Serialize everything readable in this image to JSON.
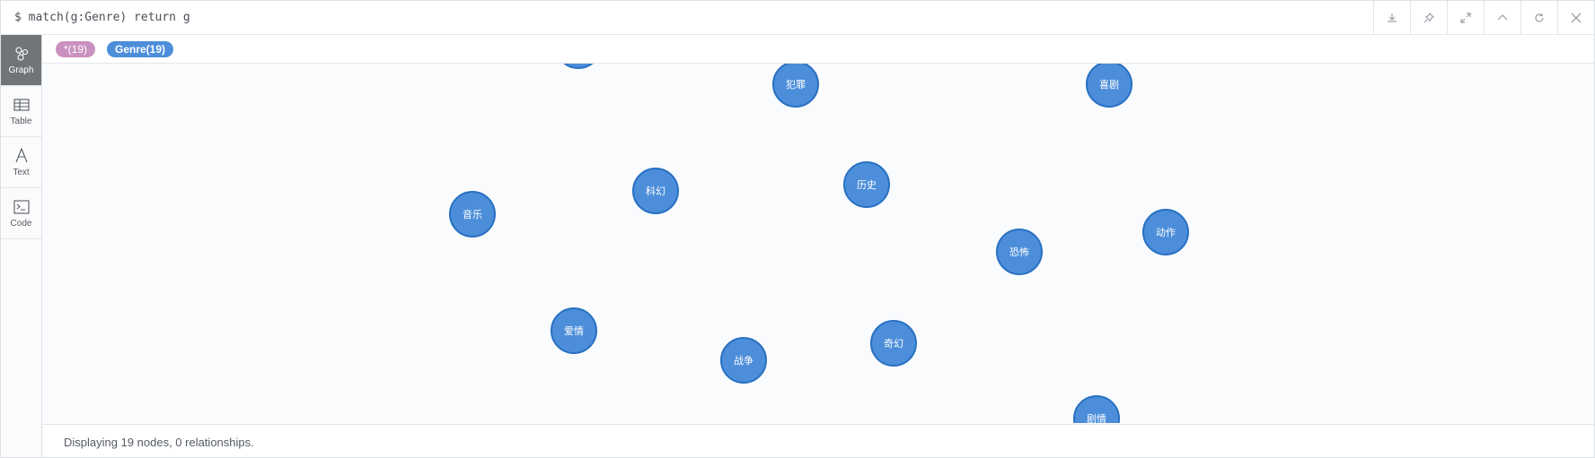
{
  "header": {
    "query": "$ match(g:Genre) return g",
    "buttons": [
      {
        "name": "download-icon"
      },
      {
        "name": "pin-icon"
      },
      {
        "name": "expand-icon"
      },
      {
        "name": "collapse-icon"
      },
      {
        "name": "rerun-icon"
      },
      {
        "name": "close-icon"
      }
    ]
  },
  "sidebar": {
    "items": [
      {
        "label": "Graph",
        "icon": "graph-icon",
        "active": true
      },
      {
        "label": "Table",
        "icon": "table-icon",
        "active": false
      },
      {
        "label": "Text",
        "icon": "text-icon",
        "active": false
      },
      {
        "label": "Code",
        "icon": "code-icon",
        "active": false
      }
    ]
  },
  "tags": {
    "all": "*(19)",
    "genre": "Genre(19)"
  },
  "nodes": [
    {
      "label": "犯罪"
    },
    {
      "label": "喜剧"
    },
    {
      "label": "科幻"
    },
    {
      "label": "历史"
    },
    {
      "label": "音乐"
    },
    {
      "label": "动作"
    },
    {
      "label": "恐怖"
    },
    {
      "label": "爱情"
    },
    {
      "label": "奇幻"
    },
    {
      "label": "战争"
    },
    {
      "label": "剧情"
    },
    {
      "label": ""
    }
  ],
  "footer": {
    "status": "Displaying 19 nodes, 0 relationships."
  },
  "colors": {
    "node_fill": "#4c8eda",
    "node_border": "#2870c2",
    "tag_all": "#c990c0",
    "tag_genre": "#4c8eda",
    "active_tab": "#727578"
  }
}
